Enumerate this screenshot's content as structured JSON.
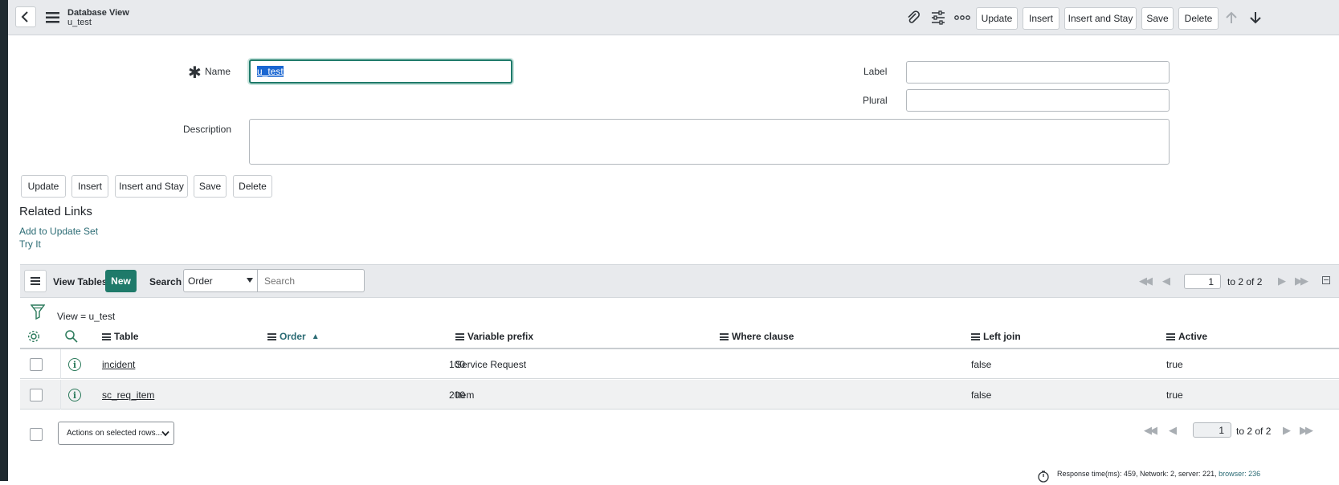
{
  "header": {
    "title": "Database View",
    "subtitle": "u_test",
    "buttons": {
      "update": "Update",
      "insert": "Insert",
      "insert_stay": "Insert and Stay",
      "save": "Save",
      "delete": "Delete"
    }
  },
  "form": {
    "name_label": "Name",
    "name_value": "u_test",
    "label_label": "Label",
    "label_value": "",
    "plural_label": "Plural",
    "plural_value": "",
    "description_label": "Description",
    "description_value": ""
  },
  "form_buttons": {
    "update": "Update",
    "insert": "Insert",
    "insert_stay": "Insert and Stay",
    "save": "Save",
    "delete": "Delete"
  },
  "related_links": {
    "heading": "Related Links",
    "links": [
      "Add to Update Set",
      "Try It"
    ]
  },
  "list": {
    "title": "View Tables",
    "new_button": "New",
    "search_label": "Search",
    "search_field": "Order",
    "search_placeholder": "Search",
    "page_value": "1",
    "page_range": "to 2 of 2",
    "filter_text": "View = u_test",
    "columns": [
      "Table",
      "Order",
      "Variable prefix",
      "Where clause",
      "Left join",
      "Active"
    ],
    "rows": [
      {
        "table": "incident",
        "order": "100",
        "prefix": "Service Request",
        "where": "",
        "left_join": "false",
        "active": "true"
      },
      {
        "table": "sc_req_item",
        "order": "200",
        "prefix": "Item",
        "where": "",
        "left_join": "false",
        "active": "true"
      }
    ],
    "actions_label": "Actions on selected rows...",
    "footer_page_value": "1",
    "footer_page_range": "to 2 of 2"
  },
  "status": {
    "response_prefix": "Response time(ms): 459, Network: 2, server: 221,",
    "browser_text": "browser: 236"
  },
  "colors": {
    "accent": "#1f7a6a",
    "link": "#2b6b74",
    "header_bg": "#e8eaed",
    "selection": "#1a66d1"
  }
}
